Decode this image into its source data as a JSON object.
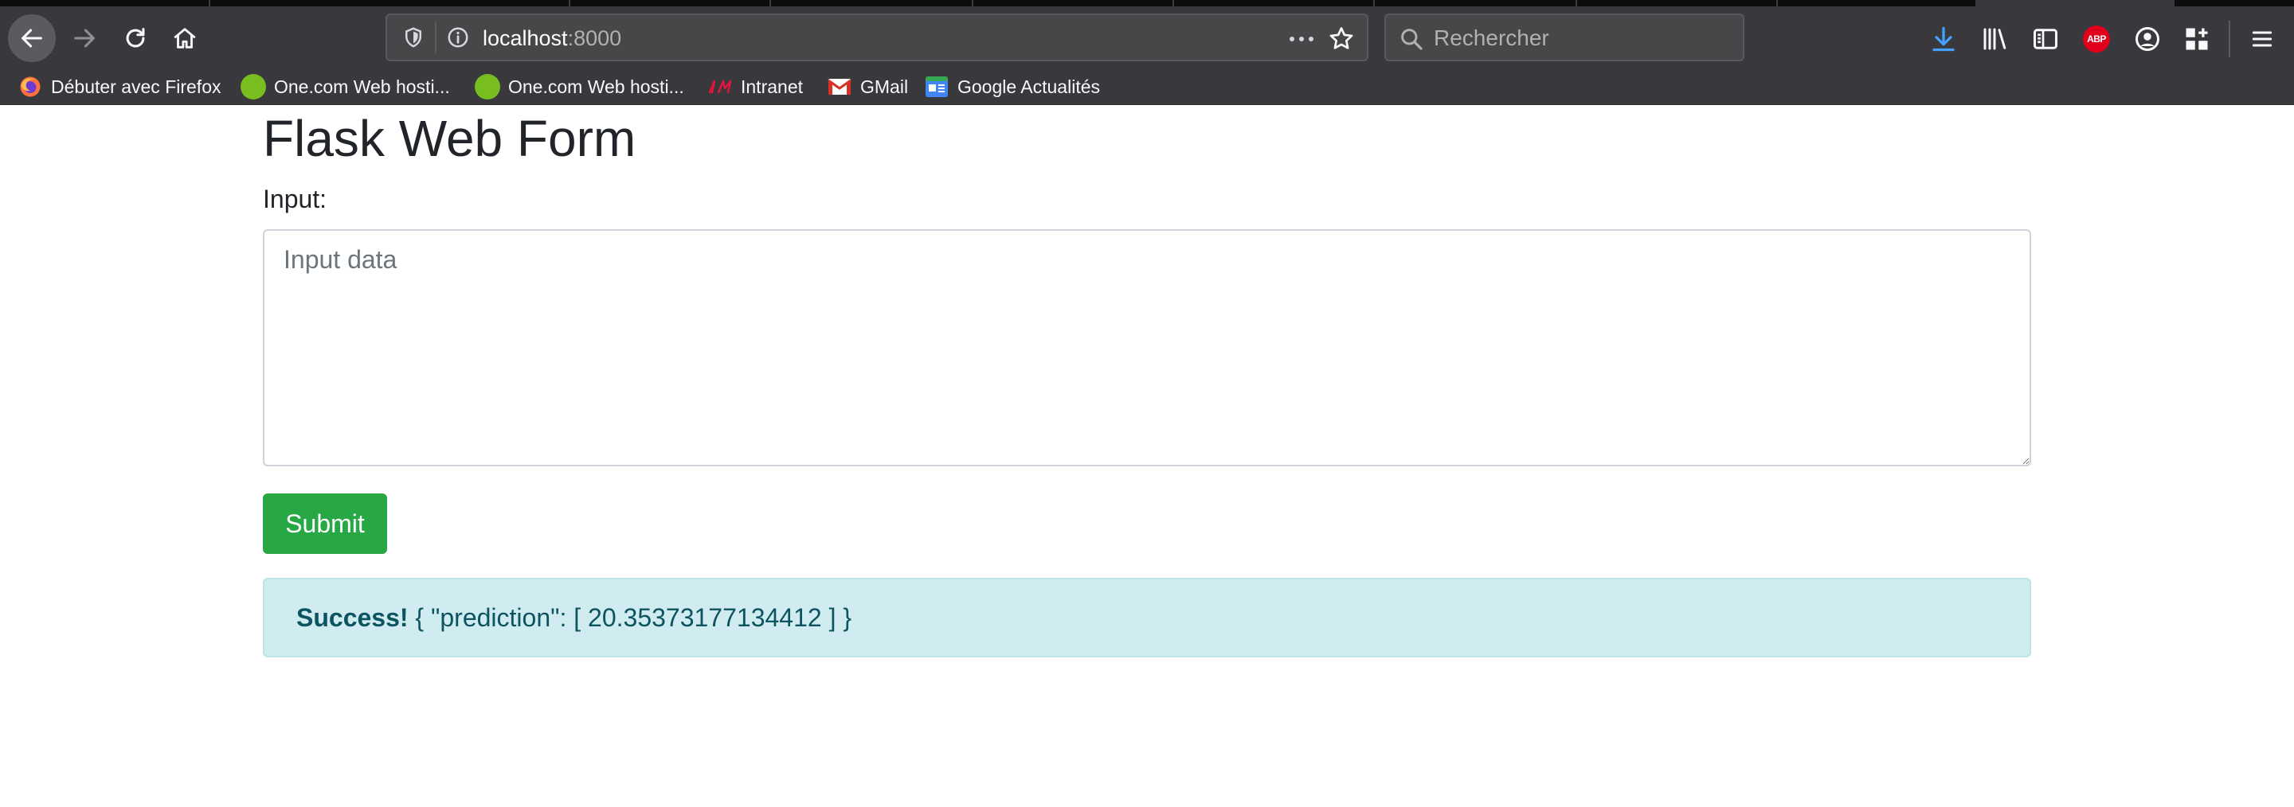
{
  "browser": {
    "url_host": "localhost",
    "url_port": ":8000",
    "search_placeholder": "Rechercher",
    "abp_label": "ABP",
    "bookmarks": [
      {
        "label": "Débuter avec Firefox",
        "icon": "firefox-icon"
      },
      {
        "label": "One.com Web hosti...",
        "icon": "onecom-icon"
      },
      {
        "label": "One.com Web hosti...",
        "icon": "onecom-icon"
      },
      {
        "label": "Intranet",
        "icon": "intranet-logo-icon"
      },
      {
        "label": "GMail",
        "icon": "gmail-icon"
      },
      {
        "label": "Google Actualités",
        "icon": "google-news-icon"
      }
    ],
    "colors": {
      "chrome": "#38383d",
      "download_accent": "#45a1ff"
    }
  },
  "page": {
    "title": "Flask Web Form",
    "input_label": "Input:",
    "input_placeholder": "Input data",
    "submit_label": "Submit",
    "alert": {
      "strong": "Success!",
      "message": " { \"prediction\": [ 20.35373177134412 ] }"
    },
    "colors": {
      "submit": "#28a745",
      "alert_bg": "#d1ecf1",
      "alert_text": "#0c5460"
    }
  }
}
